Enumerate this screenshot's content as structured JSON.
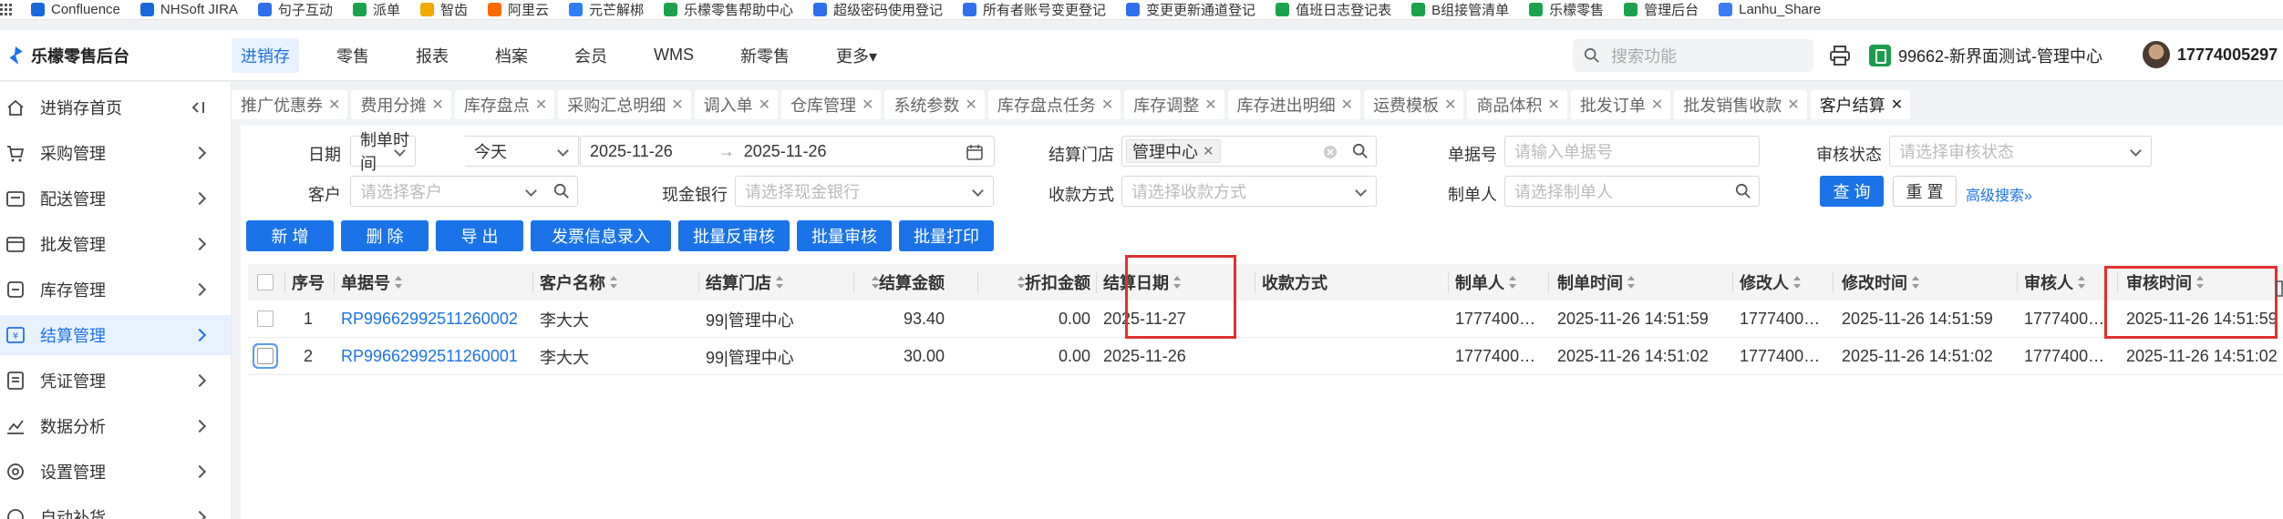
{
  "bookmarks": [
    {
      "label": "Confluence",
      "icon": "confluence-icon",
      "color": "#1868db"
    },
    {
      "label": "NHSoft JIRA",
      "icon": "jira-icon",
      "color": "#1868db"
    },
    {
      "label": "句子互动",
      "icon": "juzi-icon",
      "color": "#2f6fed"
    },
    {
      "label": "派单",
      "icon": "paidan-icon",
      "color": "#1aa34a"
    },
    {
      "label": "智齿",
      "icon": "zhichi-icon",
      "color": "#f2a900"
    },
    {
      "label": "阿里云",
      "icon": "aliyun-icon",
      "color": "#ff6a00"
    },
    {
      "label": "元芒解梆",
      "icon": "yuanmang-icon",
      "color": "#2e7df6"
    },
    {
      "label": "乐檬零售帮助中心",
      "icon": "help-center-icon",
      "color": "#1aa34a"
    },
    {
      "label": "超级密码使用登记",
      "icon": "doc-icon",
      "color": "#2f6fed"
    },
    {
      "label": "所有者账号变更登记",
      "icon": "doc-icon",
      "color": "#2f6fed"
    },
    {
      "label": "变更更新通道登记",
      "icon": "doc-icon",
      "color": "#2f6fed"
    },
    {
      "label": "值班日志登记表",
      "icon": "sheet-icon",
      "color": "#1aa34a"
    },
    {
      "label": "B组接管清单",
      "icon": "sheet-icon",
      "color": "#1aa34a"
    },
    {
      "label": "乐檬零售",
      "icon": "lemeng-icon",
      "color": "#1aa34a"
    },
    {
      "label": "管理后台",
      "icon": "admin-icon",
      "color": "#1aa34a"
    },
    {
      "label": "Lanhu_Share",
      "icon": "lanhu-icon",
      "color": "#3b7cf6"
    }
  ],
  "topnav": {
    "brand": "乐檬零售后台",
    "menu": [
      {
        "label": "进销存",
        "active": true
      },
      {
        "label": "零售"
      },
      {
        "label": "报表"
      },
      {
        "label": "档案"
      },
      {
        "label": "会员"
      },
      {
        "label": "WMS"
      },
      {
        "label": "新零售"
      },
      {
        "label": "更多▾"
      }
    ],
    "search_placeholder": "搜索功能",
    "store": "99662-新界面测试-管理中心",
    "user": "17774005297"
  },
  "sidebar": {
    "items": [
      {
        "label": "进销存首页",
        "icon": "home-icon"
      },
      {
        "label": "采购管理",
        "icon": "cart-icon"
      },
      {
        "label": "配送管理",
        "icon": "delivery-icon"
      },
      {
        "label": "批发管理",
        "icon": "wholesale-icon"
      },
      {
        "label": "库存管理",
        "icon": "inventory-icon"
      },
      {
        "label": "结算管理",
        "icon": "settlement-icon",
        "active": true
      },
      {
        "label": "凭证管理",
        "icon": "voucher-icon"
      },
      {
        "label": "数据分析",
        "icon": "chart-icon"
      },
      {
        "label": "设置管理",
        "icon": "settings-icon"
      },
      {
        "label": "自动补货",
        "icon": "replenish-icon"
      }
    ]
  },
  "tabs": [
    {
      "label": "推广优惠券"
    },
    {
      "label": "费用分摊"
    },
    {
      "label": "库存盘点"
    },
    {
      "label": "采购汇总明细"
    },
    {
      "label": "调入单"
    },
    {
      "label": "仓库管理"
    },
    {
      "label": "系统参数"
    },
    {
      "label": "库存盘点任务"
    },
    {
      "label": "库存调整"
    },
    {
      "label": "库存进出明细"
    },
    {
      "label": "运费模板"
    },
    {
      "label": "商品体积"
    },
    {
      "label": "批发订单"
    },
    {
      "label": "批发销售收款"
    },
    {
      "label": "客户结算",
      "active": true
    }
  ],
  "filters": {
    "date_label": "日期",
    "date_type": "制单时间",
    "date_preset": "今天",
    "date_start": "2025-11-26",
    "date_arrow": "→",
    "date_end": "2025-11-26",
    "store_label": "结算门店",
    "store_tag": "管理中心",
    "docno_label": "单据号",
    "docno_placeholder": "请输入单据号",
    "audit_label": "审核状态",
    "audit_placeholder": "请选择审核状态",
    "customer_label": "客户",
    "customer_placeholder": "请选择客户",
    "bank_label": "现金银行",
    "bank_placeholder": "请选择现金银行",
    "paymethod_label": "收款方式",
    "paymethod_placeholder": "请选择收款方式",
    "maker_label": "制单人",
    "maker_placeholder": "请选择制单人",
    "query": "查 询",
    "reset": "重 置",
    "advanced": "高级搜索»"
  },
  "toolbar": {
    "new": "新 增",
    "delete": "删 除",
    "export": "导 出",
    "invoice": "发票信息录入",
    "batch_unaudit": "批量反审核",
    "batch_audit": "批量审核",
    "batch_print": "批量打印"
  },
  "table": {
    "columns": [
      "序号",
      "单据号",
      "客户名称",
      "结算门店",
      "结算金额",
      "折扣金额",
      "结算日期",
      "收款方式",
      "制单人",
      "制单时间",
      "修改人",
      "修改时间",
      "审核人",
      "审核时间"
    ],
    "rows": [
      {
        "seq": "1",
        "docno": "RP99662992511260002",
        "customer": "李大大",
        "store": "99|管理中心",
        "amount": "93.40",
        "discount": "0.00",
        "settle_date": "2025-11-27",
        "paymethod": "",
        "maker": "1777400…",
        "make_time": "2025-11-26 14:51:59",
        "modifier": "1777400…",
        "modify_time": "2025-11-26 14:51:59",
        "auditor": "1777400…",
        "audit_time": "2025-11-26 14:51:59"
      },
      {
        "seq": "2",
        "docno": "RP99662992511260001",
        "customer": "李大大",
        "store": "99|管理中心",
        "amount": "30.00",
        "discount": "0.00",
        "settle_date": "2025-11-26",
        "paymethod": "",
        "maker": "1777400…",
        "make_time": "2025-11-26 14:51:02",
        "modifier": "1777400…",
        "modify_time": "2025-11-26 14:51:02",
        "auditor": "1777400…",
        "audit_time": "2025-11-26 14:51:02"
      }
    ]
  },
  "accent_color": "#1a73e8",
  "highlight_color": "#e03131"
}
